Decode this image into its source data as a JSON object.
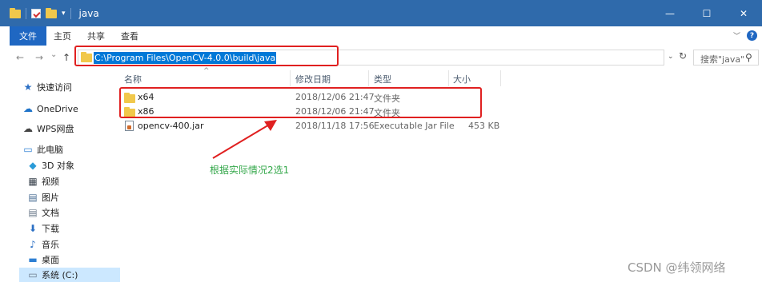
{
  "window": {
    "title": "java",
    "quick_access_dropdown": "▾",
    "controls": {
      "minimize": "—",
      "maximize": "☐",
      "close": "✕"
    }
  },
  "ribbon": {
    "tabs": [
      "文件",
      "主页",
      "共享",
      "查看"
    ],
    "expand_glyph": "﹀",
    "help_glyph": "?"
  },
  "address": {
    "back": "←",
    "forward": "→",
    "recent": "⌄",
    "up": "↑",
    "path": "C:\\Program Files\\OpenCV-4.0.0\\build\\java",
    "dropdown": "⌄",
    "refresh": "↻",
    "search_placeholder": "搜索\"java\"",
    "search_glyph": "⚲"
  },
  "sidebar": {
    "items": [
      {
        "label": "快速访问",
        "icon": "pin-icon",
        "glyph": "★",
        "color": "#2b6fc4"
      },
      {
        "label": "OneDrive",
        "icon": "cloud-icon",
        "glyph": "☁",
        "color": "#1e73c9"
      },
      {
        "label": "WPS网盘",
        "icon": "cloud-outline-icon",
        "glyph": "☁",
        "color": "#444444"
      },
      {
        "label": "此电脑",
        "icon": "computer-icon",
        "glyph": "▭",
        "color": "#2d7fd3"
      },
      {
        "label": "3D 对象",
        "icon": "cube-icon",
        "glyph": "◆",
        "color": "#2a9bd8"
      },
      {
        "label": "视频",
        "icon": "video-icon",
        "glyph": "▦",
        "color": "#39424d"
      },
      {
        "label": "图片",
        "icon": "pictures-icon",
        "glyph": "▤",
        "color": "#4a6e94"
      },
      {
        "label": "文档",
        "icon": "documents-icon",
        "glyph": "▤",
        "color": "#6b7a8a"
      },
      {
        "label": "下载",
        "icon": "download-icon",
        "glyph": "⬇",
        "color": "#2b6fc4"
      },
      {
        "label": "音乐",
        "icon": "music-icon",
        "glyph": "♪",
        "color": "#2b6fc4"
      },
      {
        "label": "桌面",
        "icon": "desktop-icon",
        "glyph": "▬",
        "color": "#2d7fd3"
      },
      {
        "label": "系统 (C:)",
        "icon": "drive-icon",
        "glyph": "▭",
        "color": "#6b7a8a"
      }
    ]
  },
  "columns": [
    "名称",
    "修改日期",
    "类型",
    "大小"
  ],
  "sort_indicator": "^",
  "files": [
    {
      "name": "x64",
      "modified": "2018/12/06 21:47",
      "type": "文件夹",
      "size": "",
      "icon": "folder-icon"
    },
    {
      "name": "x86",
      "modified": "2018/12/06 21:47",
      "type": "文件夹",
      "size": "",
      "icon": "folder-icon"
    },
    {
      "name": "opencv-400.jar",
      "modified": "2018/11/18 17:56",
      "type": "Executable Jar File",
      "size": "453 KB",
      "icon": "jar-file-icon"
    }
  ],
  "annotation": {
    "text": "根据实际情况2选1",
    "color": "#35a84b",
    "highlight_color": "#e02020"
  },
  "watermark": "CSDN @纬领网络",
  "colors": {
    "titlebar": "#2f6aab",
    "file_tab": "#1f67c2",
    "selection": "#0078d7",
    "nav_selected": "#cce8ff"
  }
}
